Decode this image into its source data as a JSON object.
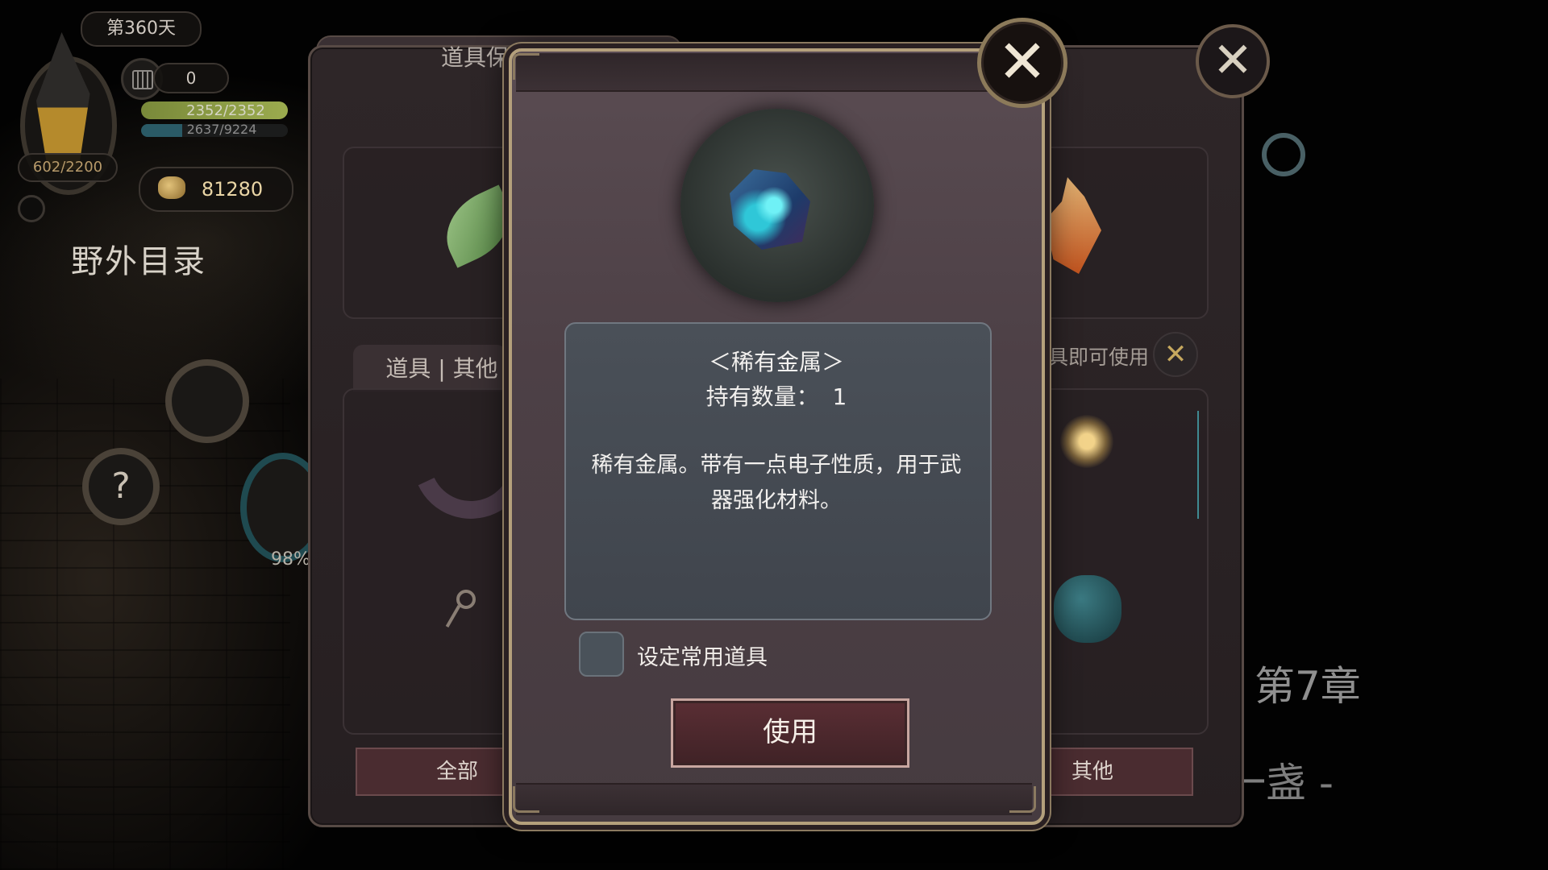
{
  "hud": {
    "day_label": "第360天",
    "counter_value": "0",
    "hp_text": "2352/2352",
    "hp_fraction": 1.0,
    "mp_text": "2637/9224",
    "mp_fraction": 0.286,
    "capacity_text": "602/2200",
    "gold_amount": "81280",
    "field_directory": "野外目录",
    "progress_percent": "98%"
  },
  "side_text": {
    "chapter": "第7章",
    "chapter_subtitle": "后一盏 -"
  },
  "chest_panel": {
    "title": "道具保管箱",
    "tab_label": "道具 | 其他",
    "auto_use_text": "具即可使用",
    "categories": [
      {
        "label": "全部",
        "active": true
      },
      {
        "label": "",
        "active": false
      },
      {
        "label": "",
        "active": false
      },
      {
        "label": "其他",
        "active": true
      }
    ],
    "close_symbol": "✕"
  },
  "item_detail": {
    "name": "＜稀有金属＞",
    "quantity_label": "持有数量：",
    "quantity_value": "1",
    "description": "稀有金属。带有一点电子性质，用于武器强化材料。",
    "favorite_label": "设定常用道具",
    "favorite_checked": false,
    "use_button": "使用",
    "close_symbol": "✕"
  },
  "icons": {
    "item": "rare-metal-icon",
    "gold": "gold-coin-icon",
    "calendar": "calendar-icon",
    "settings": "gear-icon",
    "help": "question-icon"
  },
  "colors": {
    "dialog_border": "#b4a07c",
    "use_button": "#5a2e34",
    "hp_bar": "#b5c85b"
  }
}
